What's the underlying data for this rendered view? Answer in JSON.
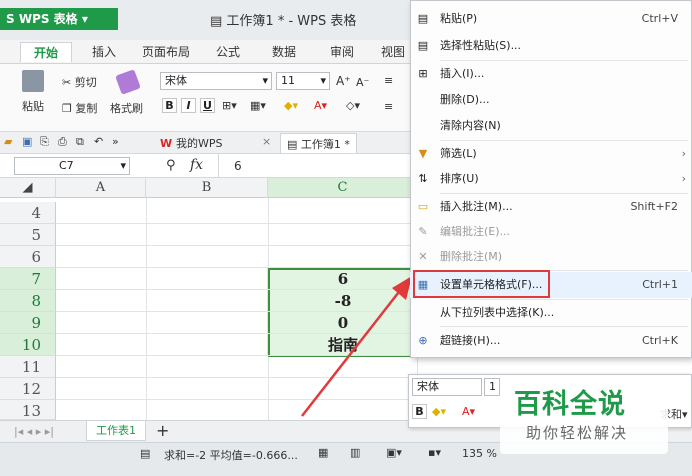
{
  "app": {
    "name": "WPS 表格",
    "window_title": "工作簿1 * - WPS 表格"
  },
  "ribbon_tabs": [
    "开始",
    "插入",
    "页面布局",
    "公式",
    "数据",
    "审阅",
    "视图"
  ],
  "ribbon": {
    "paste": "粘贴",
    "cut": "剪切",
    "copy": "复制",
    "format_painter": "格式刷",
    "font_name": "宋体",
    "font_size": "11",
    "bold": "B",
    "italic": "I",
    "underline": "U"
  },
  "quick_bar": {
    "doc_tab_1": "我的WPS",
    "doc_tab_2": "工作簿1 *"
  },
  "formula_bar": {
    "name_box": "C7",
    "fx": "fx",
    "value": "6"
  },
  "columns": [
    "A",
    "B",
    "C"
  ],
  "rows": [
    {
      "num": "4",
      "c": ""
    },
    {
      "num": "5",
      "c": ""
    },
    {
      "num": "6",
      "c": ""
    },
    {
      "num": "7",
      "c": "6"
    },
    {
      "num": "8",
      "c": "-8"
    },
    {
      "num": "9",
      "c": "0"
    },
    {
      "num": "10",
      "c": "指南"
    },
    {
      "num": "11",
      "c": ""
    },
    {
      "num": "12",
      "c": ""
    },
    {
      "num": "13",
      "c": ""
    }
  ],
  "context_menu": [
    {
      "label": "粘贴(P)",
      "shortcut": "Ctrl+V",
      "icon": "paste-icon"
    },
    {
      "label": "选择性粘贴(S)...",
      "shortcut": "",
      "icon": "paste-special-icon"
    },
    {
      "label": "插入(I)...",
      "shortcut": "",
      "icon": "insert-icon"
    },
    {
      "label": "删除(D)...",
      "shortcut": "",
      "icon": ""
    },
    {
      "label": "清除内容(N)",
      "shortcut": "",
      "icon": ""
    },
    {
      "label": "筛选(L)",
      "shortcut": "",
      "icon": "filter-icon"
    },
    {
      "label": "排序(U)",
      "shortcut": "",
      "icon": "sort-icon"
    },
    {
      "label": "插入批注(M)...",
      "shortcut": "Shift+F2",
      "icon": "comment-icon"
    },
    {
      "label": "编辑批注(E)...",
      "shortcut": "",
      "icon": "edit-comment-icon"
    },
    {
      "label": "删除批注(M)",
      "shortcut": "",
      "icon": "delete-comment-icon"
    },
    {
      "label": "设置单元格格式(F)...",
      "shortcut": "Ctrl+1",
      "icon": "format-cells-icon"
    },
    {
      "label": "从下拉列表中选择(K)...",
      "shortcut": "",
      "icon": ""
    },
    {
      "label": "超链接(H)...",
      "shortcut": "Ctrl+K",
      "icon": "hyperlink-icon"
    }
  ],
  "mini_toolbar": {
    "font": "宋体",
    "size": "1",
    "bold": "B",
    "more": "求和"
  },
  "sheet_tab": "工作表1",
  "status": {
    "summary": "求和=-2  平均值=-0.666...",
    "zoom": "135 %"
  },
  "watermark": {
    "title": "百科全说",
    "subtitle": "助你轻松解决"
  },
  "colors": {
    "accent_green": "#1f9a49",
    "selection_border": "#3e8e41",
    "highlight_red": "#e03a3a"
  }
}
